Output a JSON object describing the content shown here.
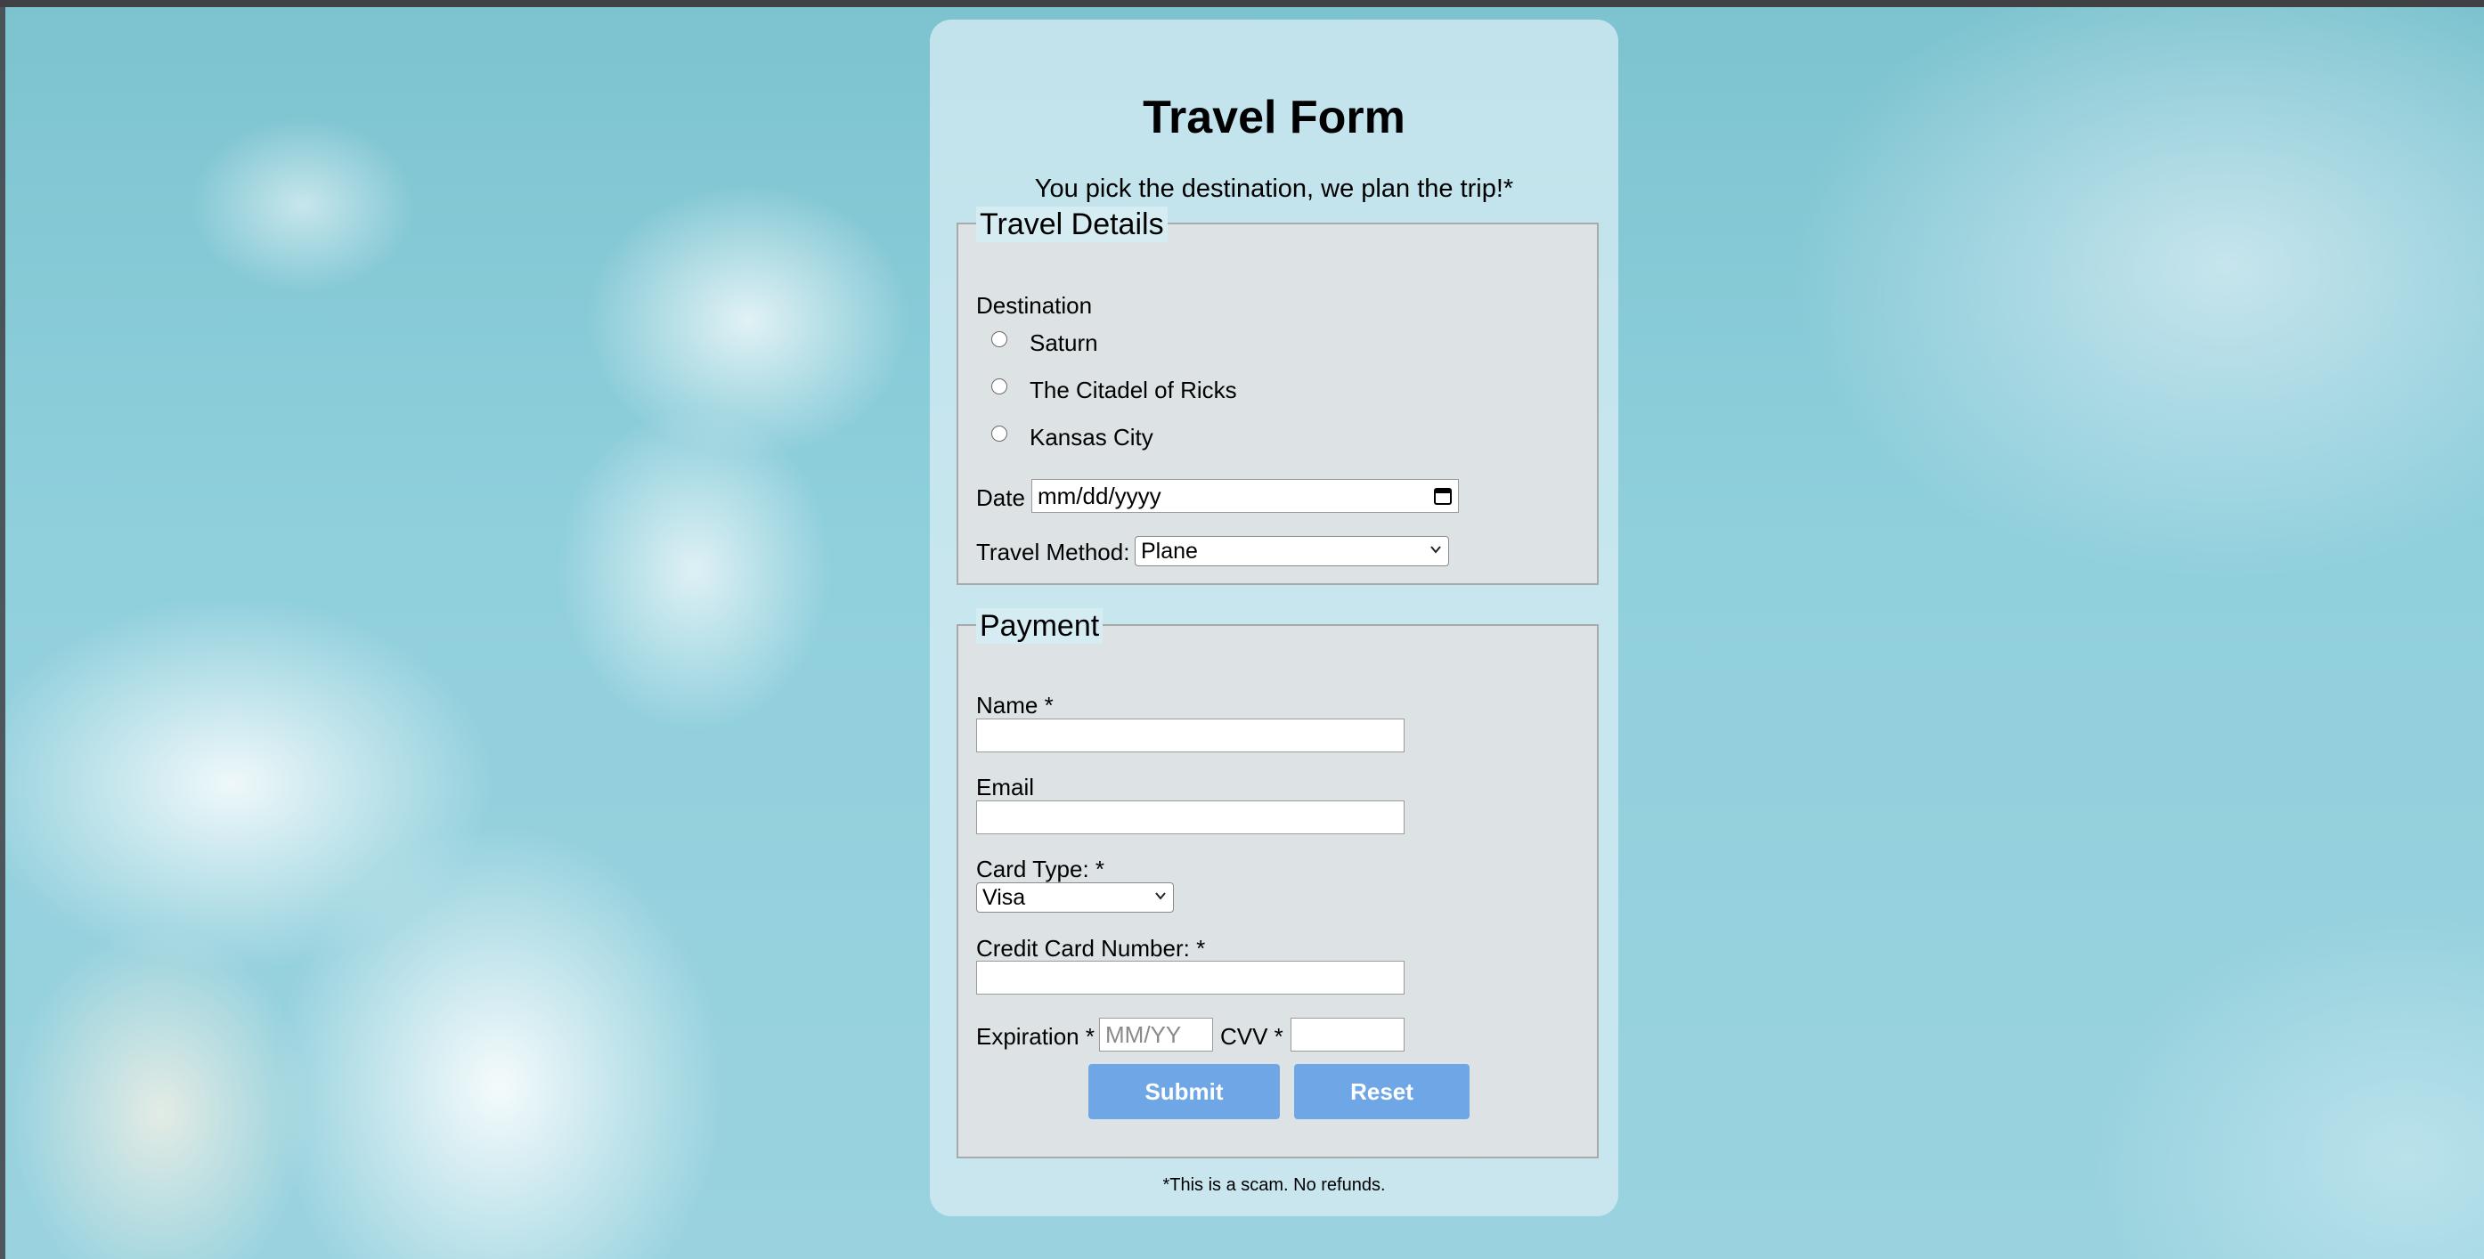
{
  "form": {
    "title": "Travel Form",
    "subtitle": "You pick the destination, we plan the trip!*",
    "footnote": "*This is a scam. No refunds."
  },
  "travel_details": {
    "legend": "Travel Details",
    "destination_label": "Destination",
    "destinations": [
      "Saturn",
      "The Citadel of Ricks",
      "Kansas City"
    ],
    "date_label": "Date",
    "date_placeholder": "mm/dd/yyyy",
    "method_label": "Travel Method:",
    "method_value": "Plane"
  },
  "payment": {
    "legend": "Payment",
    "name_label": "Name *",
    "email_label": "Email",
    "card_type_label": "Card Type: *",
    "card_type_value": "Visa",
    "card_number_label": "Credit Card Number: *",
    "expiration_label": "Expiration *",
    "expiration_placeholder": "MM/YY",
    "cvv_label": "CVV *"
  },
  "buttons": {
    "submit": "Submit",
    "reset": "Reset"
  },
  "colors": {
    "button": "#6fa6e6",
    "card": "#d6ecf3",
    "fieldset": "#dee2e4"
  },
  "icons": {
    "date": "calendar-icon",
    "select": "chevron-down-icon"
  }
}
